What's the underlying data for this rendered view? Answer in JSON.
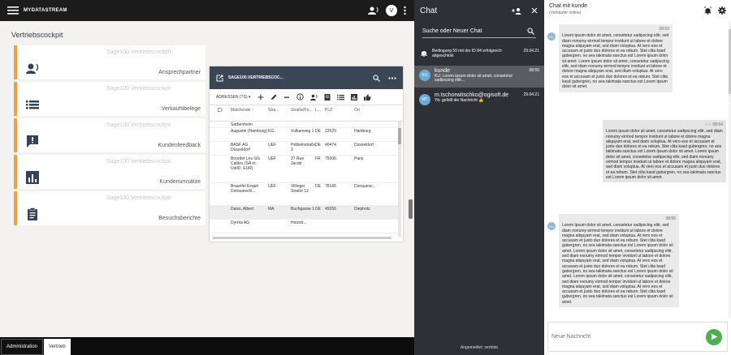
{
  "topbar": {
    "brand": "MYDATASTREAM",
    "avatar_letter": "V"
  },
  "cockpit": {
    "title": "Vertriebscockpit",
    "tiles": [
      {
        "sub": "Sage100.Vertriebscockpit",
        "label": "Ansprechpartner",
        "icon": "contacts-icon"
      },
      {
        "sub": "Sage100.Vertriebscockpit",
        "label": "Verkaufsbelege",
        "icon": "list-icon"
      },
      {
        "sub": "Sage100.Vertriebscockpit",
        "label": "Kundenfeedback",
        "icon": "feedback-icon"
      },
      {
        "sub": "Sage100.Vertriebscockpit",
        "label": "Kundenumsätze",
        "icon": "bar-chart-icon"
      },
      {
        "sub": "Sage100.Vertriebscockpit",
        "label": "Besuchsberichte",
        "icon": "clipboard-icon"
      }
    ]
  },
  "grid": {
    "title": "SAGE100.VERTRIEBSCOC...",
    "selector": "ADRESSEN (TS) ▾",
    "columns": [
      "",
      "Matchcode ↑",
      "Stra...",
      "Straße/Po...",
      "L...",
      "PLZ",
      "Ort"
    ],
    "rows": [
      [
        "",
        "Sarbenheim",
        "",
        "",
        "",
        "",
        ""
      ],
      [
        "",
        "Augustin (Hamburg)",
        "KG",
        "Vulkanweg 1",
        "DE",
        "22529",
        "Hamburg"
      ],
      [
        "",
        "BASF AG Düsseldorf",
        "UEF",
        "Holbeinstraße 3",
        "DE",
        "40474",
        "Düsseldorf"
      ],
      [
        "",
        "Bourdet Les Gîs Caldes (SA m. UstID, EUR)",
        "UEF",
        "37 Rue Jacob",
        "FR",
        "75006",
        "Paris"
      ],
      [
        "",
        "Braunfel Exquit Donaueschi...",
        "UEF",
        "Villinger Straße 12",
        "DE",
        "78166",
        "Donauesc..."
      ],
      [
        "",
        "Daiss, Albert",
        "MA",
        "Buchgasse 1",
        "DE",
        "49356",
        "Diepholz"
      ],
      [
        "",
        "Dyrrka AG",
        "",
        "Holzstr...",
        "",
        "",
        ""
      ]
    ]
  },
  "bottombar": {
    "tab_admin": "Administration",
    "tab_vertrieb": "Vertrieb"
  },
  "chat": {
    "title": "Chat",
    "search_placeholder": "Suche oder Neuer Chat",
    "notice": {
      "text": "Bedingung 50 mit der ID 84 erfolgreich abgeschickt",
      "time": "29.04.21"
    },
    "conversations": [
      {
        "initials": "KU",
        "name": "kunde",
        "msg": "KU: Lorem ipsum dolor sit amet, consetetur sadipscing elitr...",
        "time": "08:55"
      },
      {
        "initials": "MT",
        "name": "m.tschorwitschko@ogisoft.de",
        "msg": "Yb: gefällt die Nachricht 👍",
        "time": "29.04.21"
      }
    ],
    "status": "Angemeldet: vertrieb"
  },
  "conversation": {
    "title": "Chat mit kunde",
    "subtitle": "(Verkäufer online)",
    "messages": [
      {
        "dir": "in",
        "initials": "KU",
        "time": "08:53",
        "text": "Lorem ipsum dolor sit amet, consetetur sadipscing elitr, sed diam nonumy eirmod tempor invidunt ut labore et dolore magna aliquyam erat, sed diam voluptua. At vero eos et accusam et justo duo dolores et ea rebum. Stet clita kasd gubergren, no sea takimata sanctus est Lorem ipsum dolor sit amet. Lorem ipsum dolor sit amet, consetetur sadipscing elitr, sed diam nonumy eirmod tempor invidunt ut labore et dolore magna aliquyam erat, sed diam voluptua. At vero eos et accusam et justo duo dolores et ea rebum. Stet clita kasd gubergren, no sea takimata sanctus est Lorem ipsum dolor sit amet."
      },
      {
        "dir": "out",
        "initials": "",
        "time": "08:54",
        "text": "Lorem ipsum dolor sit amet, consetetur sadipscing elitr, sed diam nonumy eirmod tempor invidunt ut labore et dolore magna aliquyam erat, sed diam voluptua. At vero eos et accusam et justo duo dolores et ea rebum. Stet clita kasd gubergren, no sea takimata sanctus est Lorem ipsum dolor sit amet. Lorem ipsum dolor sit amet, consetetur sadipscing elitr, sed diam nonumy eirmod tempor invidunt ut labore et dolore magna aliquyam erat, sed diam voluptua. At vero eos et accusam et justo duo dolores et ea rebum. Stet clita kasd gubergren, no sea takimata sanctus est Lorem ipsum dolor sit amet."
      },
      {
        "dir": "in",
        "initials": "KU",
        "time": "08:55",
        "text": "Lorem ipsum dolor sit amet, consetetur sadipscing elitr, sed diam nonumy eirmod tempor invidunt ut labore et dolore magna aliquyam erat, sed diam voluptua. At vero eos et accusam et justo duo dolores et ea rebum. Stet clita kasd gubergren, no sea takimata sanctus est Lorem ipsum dolor sit amet. Lorem ipsum dolor sit amet, consetetur sadipscing elitr, sed diam nonumy eirmod tempor invidunt ut labore et dolore magna aliquyam erat, sed diam voluptua. At vero eos et accusam et justo duo dolores et ea rebum. Stet clita kasd gubergren, no sea takimata sanctus est Lorem ipsum dolor sit amet. Lorem ipsum dolor sit amet, consetetur sadipscing elitr, sed diam nonumy eirmod tempor invidunt ut labore et dolore magna aliquyam erat, sed diam voluptua. At vero eos et accusam et justo duo dolores et ea rebum. Stet clita kasd gubergren, no sea takimata sanctus est Lorem ipsum dolor sit amet."
      }
    ],
    "input_placeholder": "Neue Nachricht"
  },
  "colors": {
    "accent": "#f0a040",
    "tile_icon": "#34435a",
    "send": "#4caf50",
    "chat_bg": "#2e3035"
  }
}
